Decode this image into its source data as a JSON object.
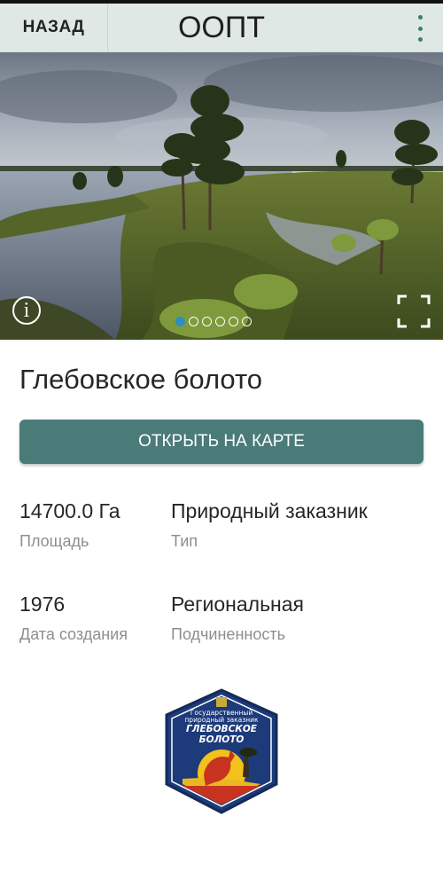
{
  "header": {
    "back_label": "НАЗАД",
    "title": "ООПТ",
    "menu_icon": "more-vert-icon"
  },
  "gallery": {
    "photo_count": 6,
    "active_index": 0,
    "info_icon": "info-icon",
    "fullscreen_icon": "fullscreen-icon",
    "active_dot_color": "#2d8fbf"
  },
  "reserve": {
    "name": "Глебовское болото",
    "map_button_label": "ОТКРЫТЬ НА КАРТЕ",
    "area_value": "14700.0 Га",
    "area_label": "Площадь",
    "type_value": "Природный заказник",
    "type_label": "Тип",
    "year_value": "1976",
    "year_label": "Дата создания",
    "subordination_value": "Региональная",
    "subordination_label": "Подчиненность"
  },
  "emblem": {
    "line1": "Государственный",
    "line2": "природный заказник",
    "line3": "ГЛЕБОВСКОЕ",
    "line4": "БОЛОТО"
  },
  "colors": {
    "header_bg": "#dfe8e4",
    "button_bg": "#4b7b78",
    "emblem_bg": "#1d3b7a"
  }
}
